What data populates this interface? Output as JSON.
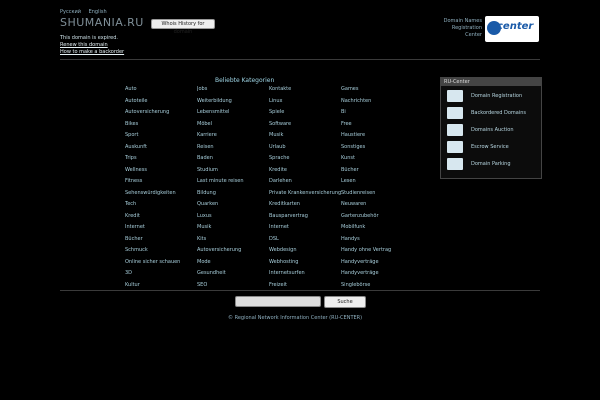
{
  "header": {
    "languages": [
      "Русский",
      "English"
    ],
    "site_title": "SHUMANIA.RU",
    "whois_button": "Whois History for domain",
    "notice": [
      "This domain is expired."
    ],
    "links": [
      "Renew this domain",
      "How to make a backorder"
    ],
    "registrar_text": [
      "Domain Names",
      "Registration",
      "Center"
    ],
    "registrar_logo_text": "center"
  },
  "categories": {
    "title": "Beliebte Kategorien",
    "items": [
      "Auto",
      "Jobs",
      "Kontakte",
      "Games",
      "Autoteile",
      "Weiterbildung",
      "Linux",
      "Nachrichten",
      "Autoversicherung",
      "Lebensmittel",
      "Spiele",
      "Bi",
      "Bikes",
      "Möbel",
      "Software",
      "Free",
      "Sport",
      "Karriere",
      "Musik",
      "Haustiere",
      "Auskunft",
      "Reisen",
      "Urlaub",
      "Sonstiges",
      "Trips",
      "Baden",
      "Sprache",
      "Kunst",
      "Wellness",
      "Studium",
      "Kredite",
      "Bücher",
      "Fitness",
      "Last minute reisen",
      "Darlehen",
      "Lesen",
      "Sehenswürdigkeiten",
      "Bildung",
      "Private Krankenversicherung",
      "Studienreisen",
      "Tech",
      "Quarken",
      "Kreditkarten",
      "Neuwaren",
      "Kredit",
      "Luxus",
      "Bausparvertrag",
      "Gartenzubehör",
      "Internet",
      "Musik",
      "Internet",
      "Mobilfunk",
      "Bücher",
      "Kits",
      "DSL",
      "Handys",
      "Schmuck",
      "Autoversicherung",
      "Webdesign",
      "Handy ohne Vertrag",
      "Online sicher schauen",
      "Mode",
      "Webhosting",
      "Handyverträge",
      "3D",
      "Gesundheit",
      "Internetsurfen",
      "Handyverträge",
      "Kultur",
      "SEO",
      "Freizeit",
      "Singlebörse"
    ]
  },
  "sidebar": {
    "title": "RU-Center",
    "items": [
      {
        "label": "Domain Registration",
        "icon": "globe-icon"
      },
      {
        "label": "Backordered Domains",
        "icon": "ru-logo-icon"
      },
      {
        "label": "Domains Auction",
        "icon": "auction-icon"
      },
      {
        "label": "Escrow Service",
        "icon": "escrow-icon"
      },
      {
        "label": "Domain Parking",
        "icon": "parking-icon"
      }
    ]
  },
  "search": {
    "placeholder": "",
    "button": "Suche"
  },
  "footer": {
    "text": "© Regional Network Information Center (RU-CENTER)"
  }
}
